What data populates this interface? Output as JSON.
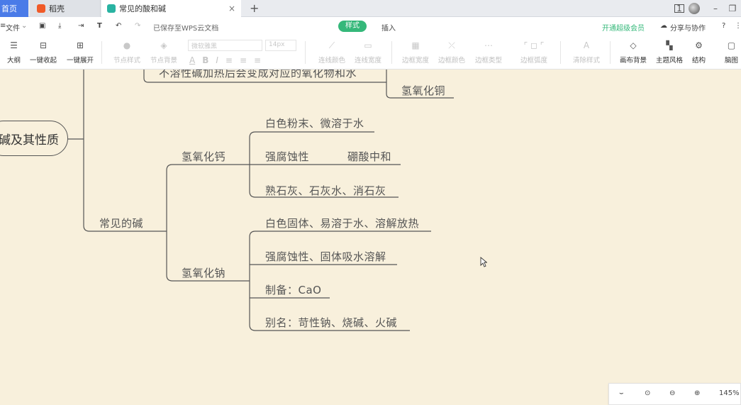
{
  "tabs": {
    "home": "首页",
    "dao": "稻壳",
    "doc": "常见的酸和碱",
    "close": "×",
    "add": "+"
  },
  "window": {
    "box": "1",
    "minimize": "–",
    "restore": "❐"
  },
  "menu": {
    "file": "文件",
    "saved": "已保存至WPS云文档",
    "style_tab": "样式",
    "insert_tab": "插入",
    "vip": "开通超级会员",
    "share": "分享与协作",
    "help": "?"
  },
  "toolbar": {
    "outline": "大纲",
    "collapse": "一键收起",
    "expand": "一键展开",
    "node_style": "节点样式",
    "node_bg": "节点背景",
    "font_name": "微软雅黑",
    "font_size": "14px",
    "line_color": "连线颜色",
    "line_width": "连线宽度",
    "border_width": "边框宽度",
    "border_color": "边框颜色",
    "border_type": "边框类型",
    "border_radius": "边框弧度",
    "clear_style": "清除样式",
    "canvas_bg": "画布背景",
    "theme": "主题风格",
    "structure": "结构",
    "mindmap": "脑图"
  },
  "mindmap": {
    "root": "碱及其性质",
    "top_partial": "不溶性碱加热后会变成对应的氧化物和水",
    "copper_hydroxide": "氢氧化铜",
    "common_bases": "常见的碱",
    "calcium_hydroxide": "氢氧化钙",
    "ca_props": [
      "白色粉末、微溶于水",
      "强腐蚀性",
      "熟石灰、石灰水、消石灰"
    ],
    "ca_boric": "硼酸中和",
    "sodium_hydroxide": "氢氧化钠",
    "na_props": [
      "白色固体、易溶于水、溶解放热",
      "强腐蚀性、固体吸水溶解",
      "制备：CaO",
      "别名：苛性钠、烧碱、火碱"
    ]
  },
  "zoom": {
    "level": "145%"
  },
  "colors": {
    "canvas": "#f8f0dc",
    "accent": "#35b87a",
    "home_tab": "#4a7be8",
    "line": "#555555"
  }
}
